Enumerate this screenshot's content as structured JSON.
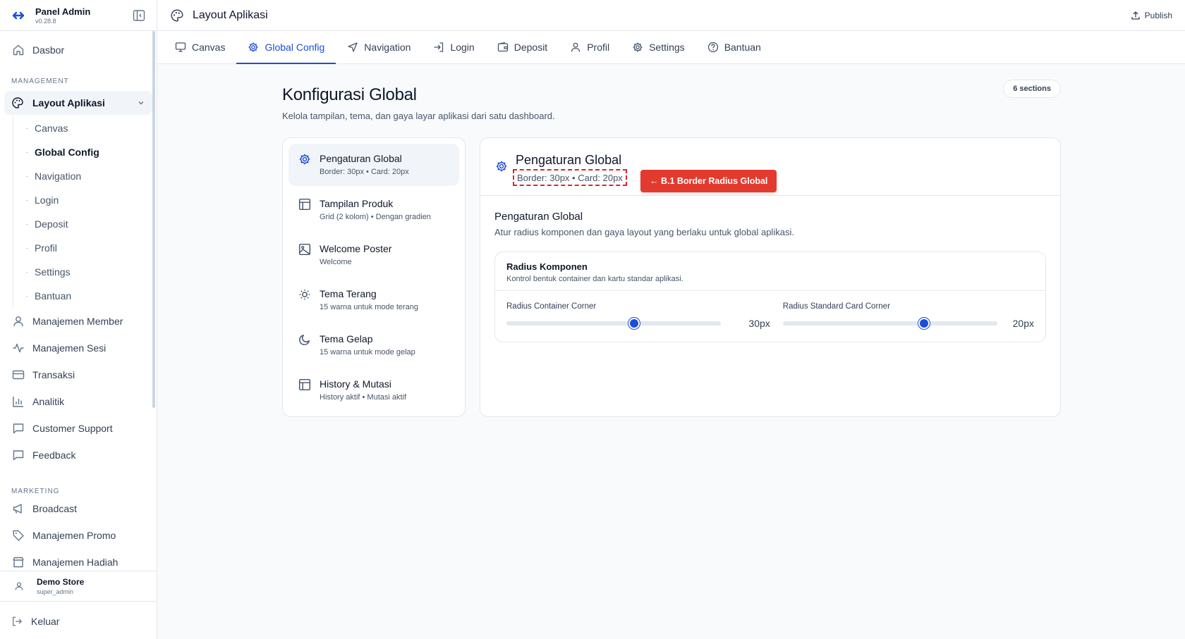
{
  "brand": {
    "name": "Panel Admin",
    "version": "v0.28.8"
  },
  "sidebar": {
    "dashboard": "Dasbor",
    "management_label": "MANAGEMENT",
    "layout_parent": "Layout Aplikasi",
    "layout_children": [
      "Canvas",
      "Global Config",
      "Navigation",
      "Login",
      "Deposit",
      "Profil",
      "Settings",
      "Bantuan"
    ],
    "management_items": [
      "Manajemen Member",
      "Manajemen Sesi",
      "Transaksi",
      "Analitik",
      "Customer Support",
      "Feedback"
    ],
    "marketing_label": "MARKETING",
    "marketing_items": [
      "Broadcast",
      "Manajemen Promo",
      "Manajemen Hadiah"
    ]
  },
  "user": {
    "name": "Demo Store",
    "role": "super_admin"
  },
  "logout_label": "Keluar",
  "topbar": {
    "title": "Layout Aplikasi",
    "publish": "Publish"
  },
  "tabs": [
    "Canvas",
    "Global Config",
    "Navigation",
    "Login",
    "Deposit",
    "Profil",
    "Settings",
    "Bantuan"
  ],
  "main": {
    "title": "Konfigurasi Global",
    "subtitle": "Kelola tampilan, tema, dan gaya layar aplikasi dari satu dashboard.",
    "sections_badge": "6 sections"
  },
  "sections": [
    {
      "name": "Pengaturan Global",
      "desc": "Border: 30px • Card: 20px"
    },
    {
      "name": "Tampilan Produk",
      "desc": "Grid (2 kolom) • Dengan gradien"
    },
    {
      "name": "Welcome Poster",
      "desc": "Welcome"
    },
    {
      "name": "Tema Terang",
      "desc": "15 warna untuk mode terang"
    },
    {
      "name": "Tema Gelap",
      "desc": "15 warna untuk mode gelap"
    },
    {
      "name": "History & Mutasi",
      "desc": "History aktif • Mutasi aktif"
    }
  ],
  "detail": {
    "title": "Pengaturan Global",
    "meta": "Border: 30px • Card: 20px",
    "callout": "← B.1 Border Radius Global",
    "body_title": "Pengaturan Global",
    "body_sub": "Atur radius komponen dan gaya layout yang berlaku untuk global aplikasi.",
    "card_title": "Radius Komponen",
    "card_sub": "Kontrol bentuk container dan kartu standar aplikasi.",
    "sliders": [
      {
        "label": "Radius Container Corner",
        "value_text": "30px",
        "fraction": 0.595
      },
      {
        "label": "Radius Standard Card Corner",
        "value_text": "20px",
        "fraction": 0.658
      }
    ]
  },
  "colors": {
    "accent": "#1d4ed8",
    "callout": "#e23b2e",
    "highlight_border": "#dc2626"
  }
}
